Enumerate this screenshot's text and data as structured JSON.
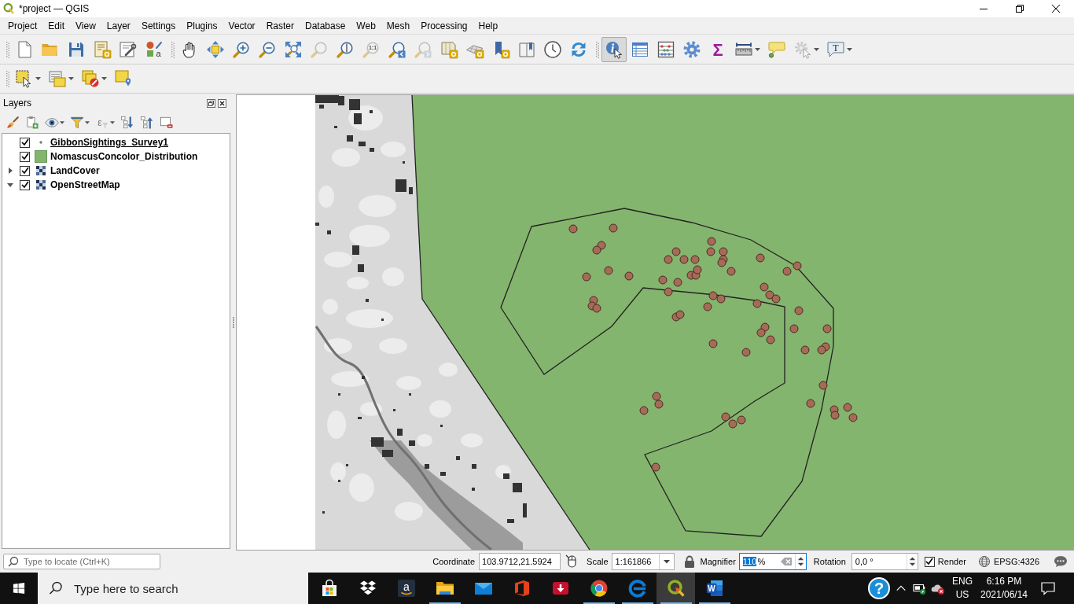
{
  "window": {
    "title": "*project — QGIS"
  },
  "menu": [
    "Project",
    "Edit",
    "View",
    "Layer",
    "Settings",
    "Plugins",
    "Vector",
    "Raster",
    "Database",
    "Web",
    "Mesh",
    "Processing",
    "Help"
  ],
  "toolbar_rows": [
    {
      "toolbars": [
        {
          "buttons": [
            {
              "kind": "new",
              "selected": false,
              "disabled": false,
              "dropdown": false
            },
            {
              "kind": "open",
              "selected": false,
              "disabled": false,
              "dropdown": false
            },
            {
              "kind": "save",
              "selected": false,
              "disabled": false,
              "dropdown": false
            },
            {
              "kind": "layout",
              "selected": false,
              "disabled": false,
              "dropdown": false
            },
            {
              "kind": "layouts",
              "selected": false,
              "disabled": false,
              "dropdown": false
            },
            {
              "kind": "style",
              "glyph": "a",
              "selected": false,
              "disabled": false,
              "dropdown": false
            }
          ]
        },
        {
          "buttons": [
            {
              "kind": "pan",
              "selected": false,
              "disabled": false,
              "dropdown": false
            },
            {
              "kind": "recenter",
              "selected": false,
              "disabled": false,
              "dropdown": false
            },
            {
              "kind": "zoomin",
              "selected": false,
              "disabled": false,
              "dropdown": false
            },
            {
              "kind": "zoomout",
              "selected": false,
              "disabled": false,
              "dropdown": false
            },
            {
              "kind": "zoomfull",
              "selected": false,
              "disabled": false,
              "dropdown": false
            },
            {
              "kind": "zoomselection",
              "selected": false,
              "disabled": true,
              "dropdown": false
            },
            {
              "kind": "zoomlayer",
              "selected": false,
              "disabled": false,
              "dropdown": false
            },
            {
              "kind": "zoomnative",
              "glyph": "1:1",
              "selected": false,
              "disabled": true,
              "dropdown": false
            },
            {
              "kind": "zoomlast",
              "selected": false,
              "disabled": false,
              "dropdown": false
            },
            {
              "kind": "zoomnext",
              "selected": false,
              "disabled": true,
              "dropdown": false
            },
            {
              "kind": "mapview",
              "selected": false,
              "disabled": false,
              "dropdown": false
            },
            {
              "kind": "map3d",
              "selected": false,
              "disabled": false,
              "dropdown": false
            },
            {
              "kind": "bookmark",
              "selected": false,
              "disabled": false,
              "dropdown": false
            },
            {
              "kind": "bookmarks",
              "selected": false,
              "disabled": false,
              "dropdown": false
            },
            {
              "kind": "clock",
              "selected": false,
              "disabled": false,
              "dropdown": false
            },
            {
              "kind": "refresh",
              "selected": false,
              "disabled": false,
              "dropdown": false
            }
          ]
        },
        {
          "buttons": [
            {
              "kind": "identify",
              "selected": true,
              "disabled": false,
              "dropdown": false
            },
            {
              "kind": "table",
              "selected": false,
              "disabled": false,
              "dropdown": false
            },
            {
              "kind": "abacus",
              "selected": false,
              "disabled": false,
              "dropdown": false
            },
            {
              "kind": "toolbox",
              "selected": false,
              "disabled": false,
              "dropdown": false
            },
            {
              "kind": "sigma",
              "glyph": "Σ",
              "selected": false,
              "disabled": false,
              "dropdown": false
            },
            {
              "kind": "ruler",
              "selected": false,
              "disabled": false,
              "dropdown": true
            },
            {
              "kind": "tips",
              "selected": false,
              "disabled": false,
              "dropdown": false
            },
            {
              "kind": "actions",
              "selected": false,
              "disabled": true,
              "dropdown": true
            },
            {
              "kind": "annotation",
              "glyph": "T",
              "selected": false,
              "disabled": false,
              "dropdown": true
            }
          ]
        }
      ]
    },
    {
      "toolbars": [
        {
          "buttons": [
            {
              "kind": "select",
              "selected": false,
              "disabled": false,
              "dropdown": true
            },
            {
              "kind": "selectattr",
              "selected": false,
              "disabled": false,
              "dropdown": true
            },
            {
              "kind": "deselect",
              "selected": false,
              "disabled": false,
              "dropdown": true
            },
            {
              "kind": "selectlocation",
              "selected": false,
              "disabled": false,
              "dropdown": false
            }
          ]
        }
      ]
    }
  ],
  "layers_panel": {
    "title": "Layers",
    "toolbar": [
      {
        "kind": "brush",
        "disabled": false,
        "dropdown": false
      },
      {
        "kind": "addgroup",
        "disabled": false,
        "dropdown": false
      },
      {
        "kind": "visibility",
        "disabled": false,
        "dropdown": true
      },
      {
        "kind": "filter",
        "disabled": false,
        "dropdown": true
      },
      {
        "kind": "expression",
        "glyph": "ε",
        "disabled": true,
        "dropdown": true
      },
      {
        "kind": "expandall",
        "disabled": false,
        "dropdown": false
      },
      {
        "kind": "collapseall",
        "disabled": false,
        "dropdown": false
      },
      {
        "kind": "remove",
        "disabled": false,
        "dropdown": false
      }
    ],
    "layers": [
      {
        "name": "GibbonSightings_Survey1",
        "kind": "point",
        "checked": true,
        "underlined": true
      },
      {
        "name": "NomascusConcolor_Distribution",
        "kind": "polygon",
        "checked": true,
        "underlined": false
      },
      {
        "name": "LandCover",
        "kind": "raster",
        "checked": true,
        "underlined": false,
        "expanded": false
      },
      {
        "name": "OpenStreetMap",
        "kind": "raster",
        "checked": true,
        "underlined": false,
        "expanded": true
      }
    ]
  },
  "status_bar": {
    "locate": {
      "placeholder": "Type to locate (Ctrl+K)"
    },
    "coordinate": {
      "label": "Coordinate",
      "value": "103.9712,21.5924"
    },
    "scale": {
      "label": "Scale",
      "value": "1:161866"
    },
    "magnifier": {
      "label": "Magnifier",
      "value": "110",
      "suffix": "%",
      "focused": true,
      "text_selected": true
    },
    "rotation": {
      "label": "Rotation",
      "value": "0,0 °"
    },
    "render": {
      "label": "Render",
      "checked": true
    },
    "crs": "EPSG:4326"
  },
  "taskbar": {
    "search": {
      "placeholder": "Type here to search"
    },
    "apps": [
      {
        "kind": "bag",
        "running": false,
        "active": false
      },
      {
        "kind": "box",
        "running": false,
        "active": false
      },
      {
        "kind": "smile",
        "glyph": "a",
        "running": false,
        "active": false
      },
      {
        "kind": "folder",
        "running": true,
        "active": false
      },
      {
        "kind": "envelope",
        "running": false,
        "active": false
      },
      {
        "kind": "office",
        "running": false,
        "active": false
      },
      {
        "kind": "download",
        "running": false,
        "active": false
      },
      {
        "kind": "wheel",
        "running": true,
        "active": false
      },
      {
        "kind": "swirl",
        "running": true,
        "active": false
      },
      {
        "kind": "lens",
        "running": true,
        "active": true
      },
      {
        "kind": "document",
        "glyph": "W",
        "running": true,
        "active": false
      }
    ],
    "help": "?",
    "language": [
      "ENG",
      "US"
    ],
    "clock": {
      "time": "6:16 PM",
      "date": "2021/06/14"
    }
  }
}
